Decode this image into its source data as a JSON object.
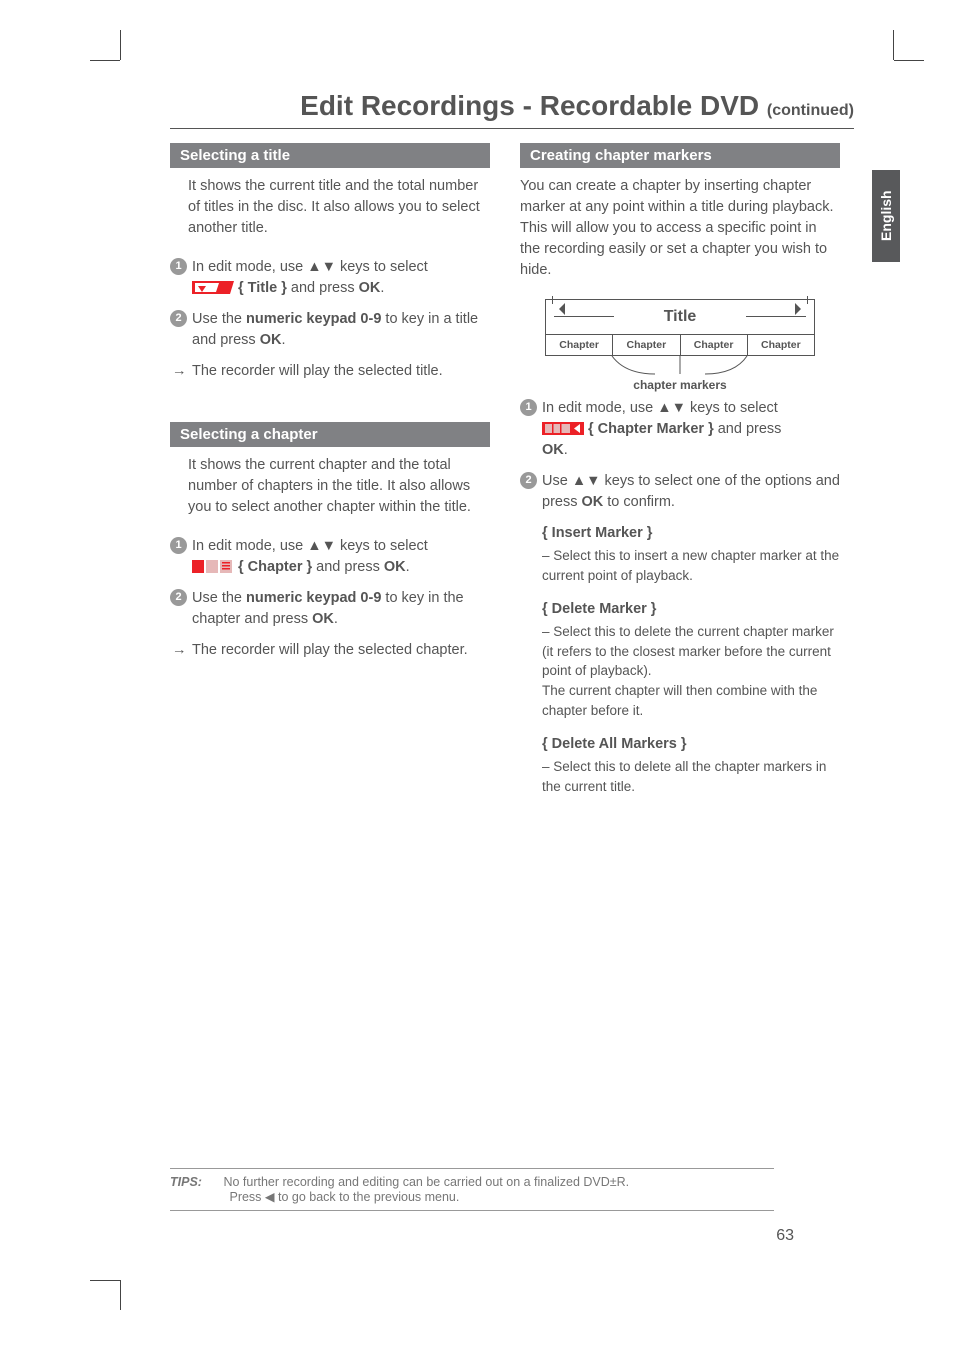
{
  "page_title_main": "Edit Recordings - Recordable DVD ",
  "page_title_cont": "(continued)",
  "lang_tab": "English",
  "left": {
    "s1": {
      "bar": "Selecting a title",
      "intro": "It shows the current title and the total number of titles in the disc. It also allows you to select another title.",
      "step1_a": "In edit mode, use ▲▼ keys to select",
      "step1_b_label": "{ Title }",
      "step1_b_rest": " and press ",
      "step1_b_ok": "OK",
      "step1_b_dot": ".",
      "step2_a": "Use the ",
      "step2_b": "numeric keypad 0-9",
      "step2_c": " to key in a title and press ",
      "step2_d": "OK",
      "step2_e": ".",
      "arrow": "The recorder will play the selected title."
    },
    "s2": {
      "bar": "Selecting a chapter",
      "intro": "It shows the current chapter and the total number of chapters in the title. It also allows you to select another chapter within the title.",
      "step1_a": "In edit mode, use ▲▼ keys to select",
      "step1_b_label": "{ Chapter }",
      "step1_b_rest": " and press ",
      "step1_b_ok": "OK",
      "step1_b_dot": ".",
      "step2_a": "Use the ",
      "step2_b": "numeric keypad 0-9",
      "step2_c": " to key in the chapter and press ",
      "step2_d": "OK",
      "step2_e": ".",
      "arrow": "The recorder will play the selected chapter."
    }
  },
  "right": {
    "bar": "Creating chapter markers",
    "intro": "You can create a chapter by inserting chapter marker at any point within a title during playback. This will allow you to access a specific point in the recording easily or set a chapter you wish to hide.",
    "diagram_title": "Title",
    "chapter_word": "Chapter",
    "diagram_caption": "chapter markers",
    "step1_a": "In edit mode, use ▲▼ keys to select",
    "step1_b_label": "{ Chapter Marker }",
    "step1_b_rest": " and press ",
    "step1_b_ok": "OK",
    "step1_b_dot": ".",
    "step2_a": "Use ▲▼ keys to select one of the options and press ",
    "step2_b": "OK",
    "step2_c": " to confirm.",
    "opt1_title": "{ Insert Marker }",
    "opt1_body": "–  Select this to insert a new chapter marker at the current point of playback.",
    "opt2_title": "{ Delete Marker }",
    "opt2_body": "–  Select this to delete the current chapter marker (it refers to the closest marker before the current point of playback).\nThe current chapter will then combine with the chapter before it.",
    "opt3_title": "{ Delete All Markers }",
    "opt3_body": "–  Select this to delete all the chapter markers in the current title."
  },
  "tips_label": "TIPS:",
  "tips_line1": "No further recording and editing can be carried out on a finalized DVD±R.",
  "tips_line2": "Press ◀ to go back to the previous menu.",
  "page_number": "63"
}
